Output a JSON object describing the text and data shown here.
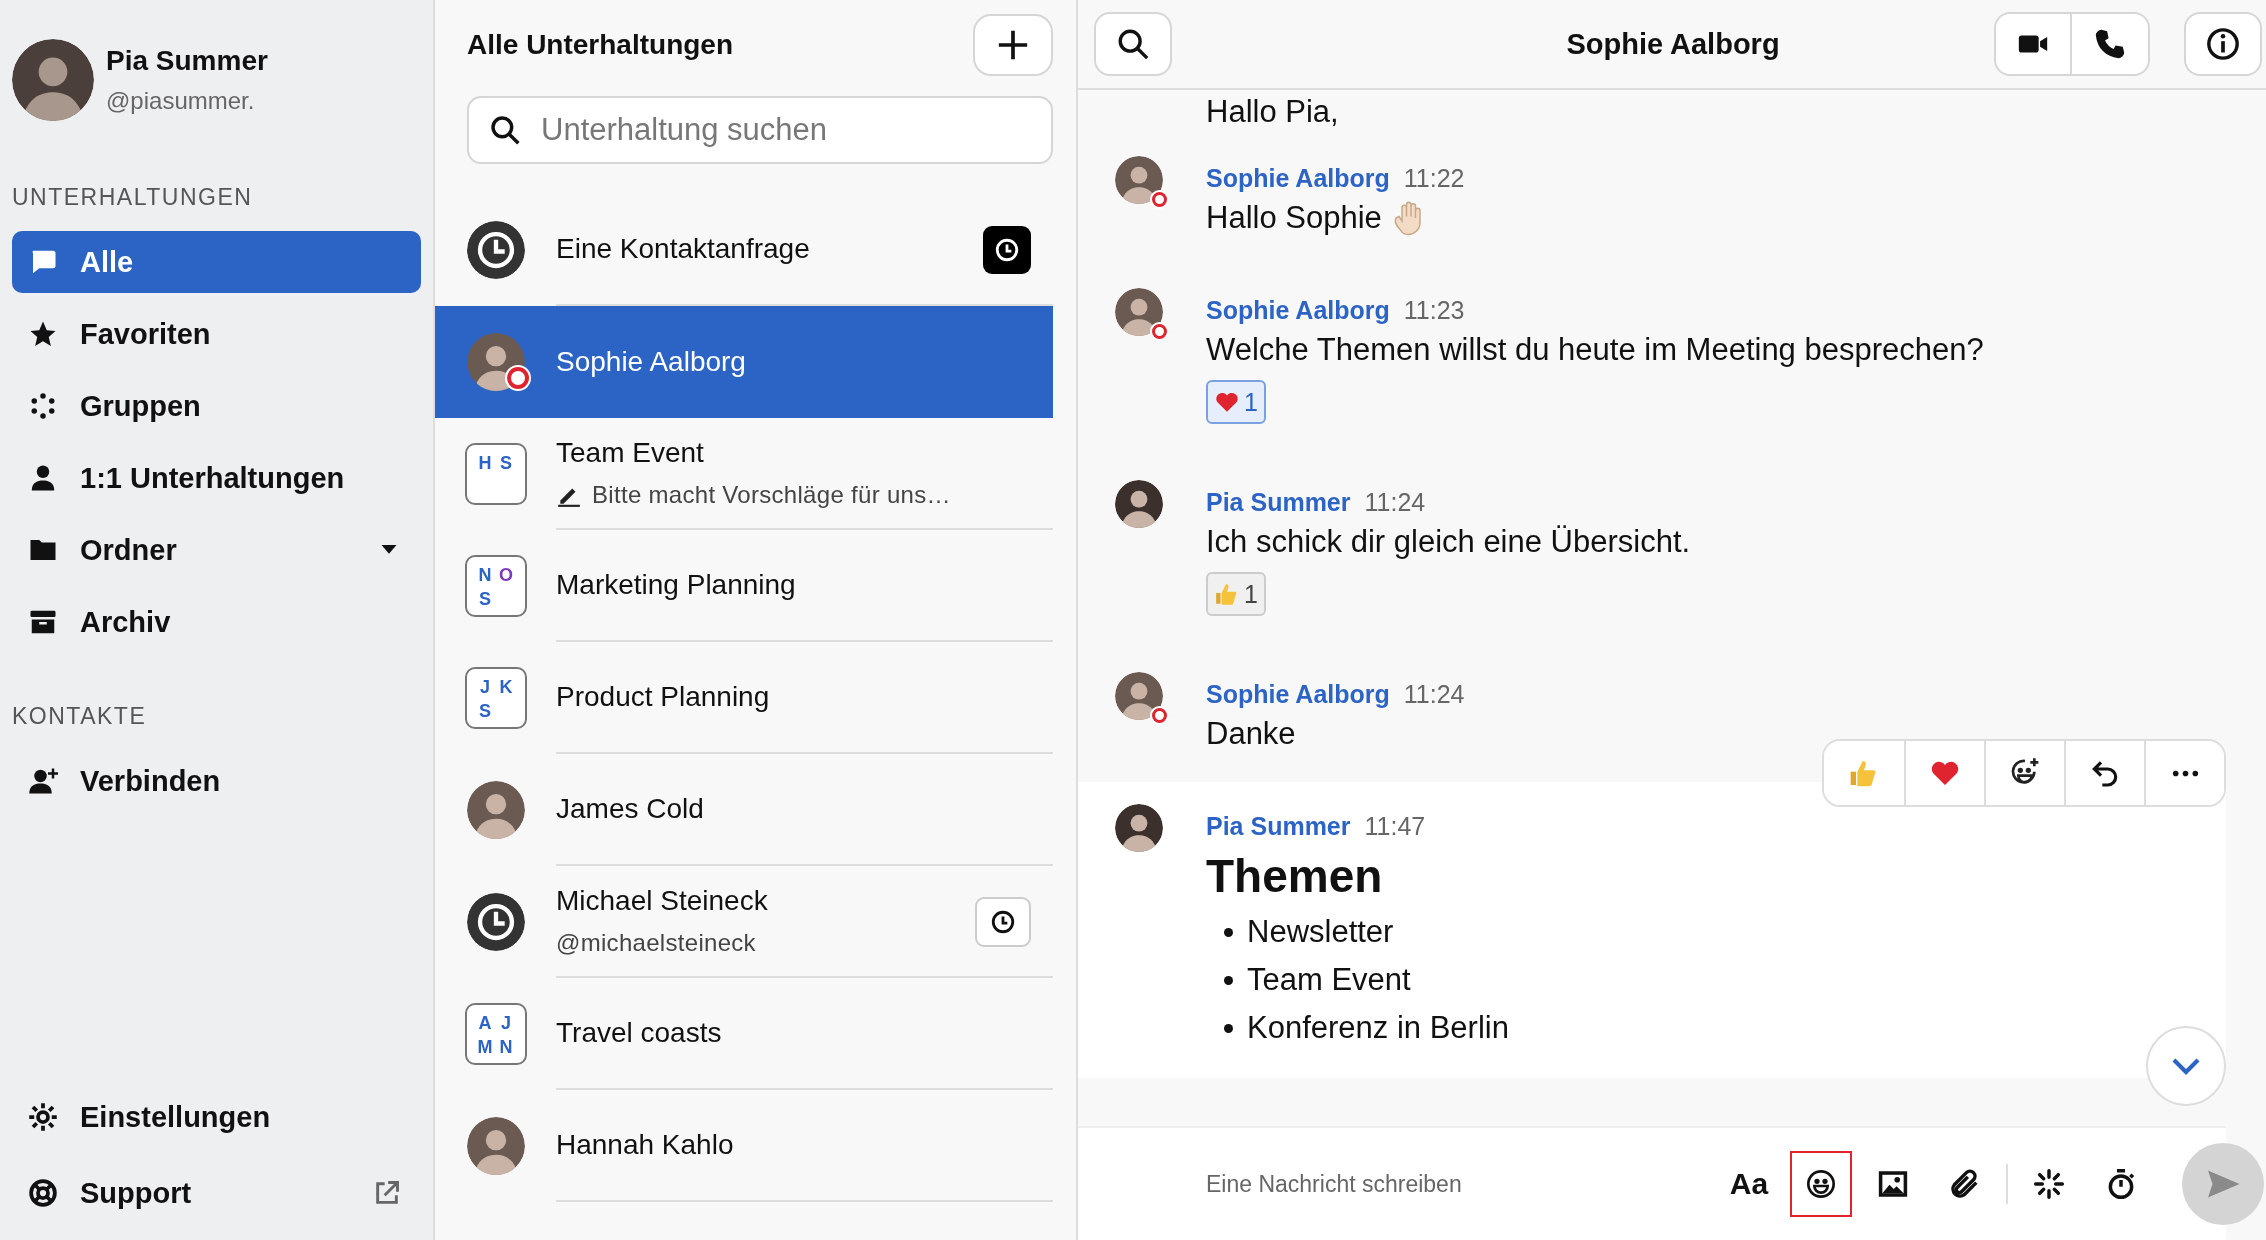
{
  "profile": {
    "name": "Pia Summer",
    "handle": "@piasummer."
  },
  "sidebar": {
    "sections": [
      {
        "heading": "UNTERHALTUNGEN",
        "items": [
          {
            "label": "Alle",
            "kind": "chat",
            "selected": true
          },
          {
            "label": "Favoriten",
            "kind": "star",
            "selected": false
          },
          {
            "label": "Gruppen",
            "kind": "group",
            "selected": false
          },
          {
            "label": "1:1 Unterhaltungen",
            "kind": "person",
            "selected": false
          },
          {
            "label": "Ordner",
            "kind": "folder",
            "selected": false
          },
          {
            "label": "Archiv",
            "kind": "archive",
            "selected": false
          }
        ]
      },
      {
        "heading": "KONTAKTE",
        "items": [
          {
            "label": "Verbinden",
            "kind": "connect",
            "selected": false
          }
        ]
      }
    ],
    "footer": [
      {
        "label": "Einstellungen",
        "kind": "settings"
      },
      {
        "label": "Support",
        "kind": "support"
      }
    ]
  },
  "conversations": {
    "title": "Alle Unterhaltungen",
    "search": {
      "placeholder": "Unterhaltung suchen"
    },
    "items": [
      {
        "name": "Eine Kontaktanfrage",
        "kind": "request",
        "selected": false,
        "pending_badge": true,
        "filled_badge": true
      },
      {
        "name": "Sophie Aalborg",
        "kind": "person",
        "selected": true,
        "busy": true
      },
      {
        "name": "Team Event",
        "kind": "group",
        "selected": false,
        "initials": [
          {
            "letter": "H",
            "color": "#2c64c6"
          },
          {
            "letter": "S",
            "color": "#2c64c6"
          }
        ],
        "subtitle": "Bitte macht Vorschläge für uns…",
        "draft": true
      },
      {
        "name": "Marketing Planning",
        "kind": "group",
        "selected": false,
        "initials": [
          {
            "letter": "N",
            "color": "#2c64c6"
          },
          {
            "letter": "O",
            "color": "#7e3ac0"
          },
          {
            "letter": "S",
            "color": "#2c64c6"
          }
        ]
      },
      {
        "name": "Product Planning",
        "kind": "group",
        "selected": false,
        "initials": [
          {
            "letter": "J",
            "color": "#2c64c6"
          },
          {
            "letter": "K",
            "color": "#2c64c6"
          },
          {
            "letter": "S",
            "color": "#2c64c6"
          }
        ]
      },
      {
        "name": "James Cold",
        "kind": "person",
        "selected": false
      },
      {
        "name": "Michael Steineck",
        "kind": "request",
        "selected": false,
        "subtitle": "@michaelsteineck",
        "pending_badge": true,
        "filled_badge": false
      },
      {
        "name": "Travel coasts",
        "kind": "group",
        "selected": false,
        "initials": [
          {
            "letter": "A",
            "color": "#2c64c6"
          },
          {
            "letter": "J",
            "color": "#2c64c6"
          },
          {
            "letter": "M",
            "color": "#2c64c6"
          },
          {
            "letter": "N",
            "color": "#2c64c6"
          }
        ]
      },
      {
        "name": "Hannah Kahlo",
        "kind": "person",
        "selected": false
      }
    ]
  },
  "chat": {
    "title": "Sophie Aalborg",
    "fragment": "Hallo Pia,",
    "messages": [
      {
        "author": "Sophie Aalborg",
        "time": "11:22",
        "busy": true,
        "text": "Hallo Sophie",
        "wave": true
      },
      {
        "author": "Sophie Aalborg",
        "time": "11:23",
        "busy": true,
        "text": "Welche Themen willst du heute im Meeting besprechen?",
        "reactions": [
          {
            "kind": "heart",
            "count": "1",
            "selected": true
          }
        ]
      },
      {
        "author": "Pia Summer",
        "time": "11:24",
        "text": "Ich schick dir gleich eine Übersicht.",
        "reactions": [
          {
            "kind": "thumbs",
            "count": "1",
            "selected": false
          }
        ]
      },
      {
        "author": "Sophie Aalborg",
        "time": "11:24",
        "busy": true,
        "text": "Danke"
      },
      {
        "author": "Pia Summer",
        "time": "11:47",
        "heading": "Themen",
        "bullets": [
          "Newsletter",
          "Team Event",
          "Konferenz in Berlin"
        ],
        "hovered": true
      }
    ],
    "composer": {
      "placeholder": "Eine Nachricht schreiben",
      "format_label": "Aa",
      "emoji_highlighted": true
    }
  }
}
